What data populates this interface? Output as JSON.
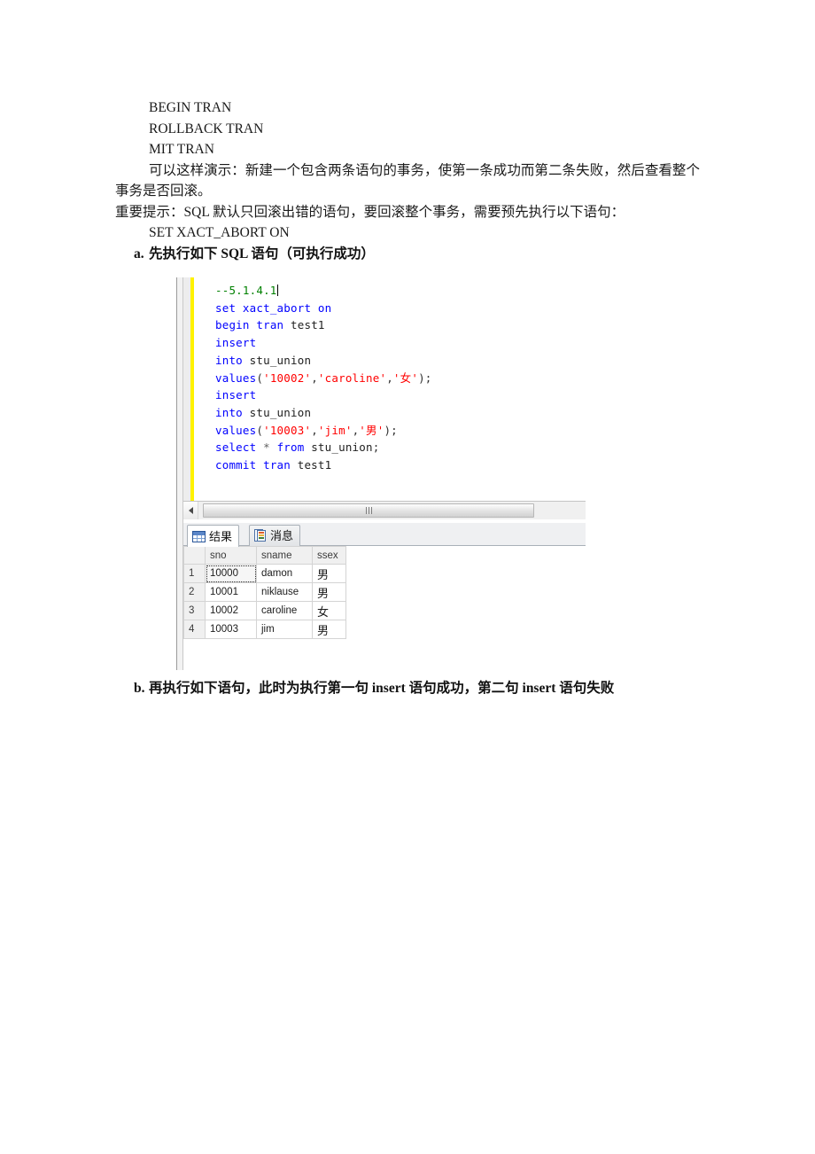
{
  "document": {
    "lines": [
      {
        "id": "l1",
        "text": "BEGIN TRAN"
      },
      {
        "id": "l2",
        "text": "ROLLBACK TRAN"
      },
      {
        "id": "l3",
        "text": "MIT TRAN"
      }
    ],
    "paragraph_1": "可以这样演示：新建一个包含两条语句的事务，使第一条成功而第二条失败，然后查看整个事务是否回滚。",
    "paragraph_2": "重要提示：SQL 默认只回滚出错的语句，要回滚整个事务，需要预先执行以下语句：",
    "statement_line": "SET XACT_ABORT ON",
    "item_a": {
      "marker": "a.",
      "text": "先执行如下 SQL 语句（可执行成功）"
    },
    "item_b": {
      "marker": "b.",
      "text": "再执行如下语句，此时为执行第一句 insert 语句成功，第二句 insert 语句失败"
    }
  },
  "ssms": {
    "editor": {
      "lines": [
        {
          "id": "c1",
          "tokens": [
            {
              "t": "--5.1.4.1",
              "k": "cmt"
            }
          ],
          "caret": true
        },
        {
          "id": "c2",
          "tokens": [
            {
              "t": "set",
              "k": "kw"
            },
            {
              "t": " ",
              "k": "pun"
            },
            {
              "t": "xact_abort",
              "k": "kw"
            },
            {
              "t": " ",
              "k": "pun"
            },
            {
              "t": "on",
              "k": "kw"
            }
          ]
        },
        {
          "id": "c3",
          "tokens": [
            {
              "t": "begin",
              "k": "kw"
            },
            {
              "t": " ",
              "k": "pun"
            },
            {
              "t": "tran",
              "k": "kw"
            },
            {
              "t": " ",
              "k": "pun"
            },
            {
              "t": "test1",
              "k": "idn"
            }
          ]
        },
        {
          "id": "c4",
          "tokens": [
            {
              "t": "insert",
              "k": "kw"
            }
          ]
        },
        {
          "id": "c5",
          "tokens": [
            {
              "t": "into",
              "k": "kw"
            },
            {
              "t": " ",
              "k": "pun"
            },
            {
              "t": "stu_union",
              "k": "idn"
            }
          ]
        },
        {
          "id": "c6",
          "tokens": [
            {
              "t": "values",
              "k": "kw"
            },
            {
              "t": "(",
              "k": "pun"
            },
            {
              "t": "'10002'",
              "k": "str"
            },
            {
              "t": ",",
              "k": "pun"
            },
            {
              "t": "'caroline'",
              "k": "str"
            },
            {
              "t": ",",
              "k": "pun"
            },
            {
              "t": "'女'",
              "k": "str"
            },
            {
              "t": ");",
              "k": "pun"
            }
          ]
        },
        {
          "id": "c7",
          "tokens": [
            {
              "t": "insert",
              "k": "kw"
            }
          ]
        },
        {
          "id": "c8",
          "tokens": [
            {
              "t": "into",
              "k": "kw"
            },
            {
              "t": " ",
              "k": "pun"
            },
            {
              "t": "stu_union",
              "k": "idn"
            }
          ]
        },
        {
          "id": "c9",
          "tokens": [
            {
              "t": "values",
              "k": "kw"
            },
            {
              "t": "(",
              "k": "pun"
            },
            {
              "t": "'10003'",
              "k": "str"
            },
            {
              "t": ",",
              "k": "pun"
            },
            {
              "t": "'jim'",
              "k": "str"
            },
            {
              "t": ",",
              "k": "pun"
            },
            {
              "t": "'男'",
              "k": "str"
            },
            {
              "t": ");",
              "k": "pun"
            }
          ]
        },
        {
          "id": "c10",
          "tokens": [
            {
              "t": "select",
              "k": "kw"
            },
            {
              "t": " ",
              "k": "pun"
            },
            {
              "t": "*",
              "k": "op"
            },
            {
              "t": " ",
              "k": "pun"
            },
            {
              "t": "from",
              "k": "kw"
            },
            {
              "t": " ",
              "k": "pun"
            },
            {
              "t": "stu_union",
              "k": "idn"
            },
            {
              "t": ";",
              "k": "pun"
            }
          ]
        },
        {
          "id": "c11",
          "tokens": [
            {
              "t": "commit",
              "k": "kw"
            },
            {
              "t": " ",
              "k": "pun"
            },
            {
              "t": "tran",
              "k": "kw"
            },
            {
              "t": " ",
              "k": "pun"
            },
            {
              "t": "test1",
              "k": "idn"
            }
          ]
        }
      ],
      "colors": {
        "keyword": "#0000ff",
        "string": "#ff0000",
        "comment": "#008000",
        "change_bar": "#fff200"
      }
    },
    "tabs": [
      {
        "id": "results",
        "label": "结果",
        "icon": "grid-icon",
        "active": true
      },
      {
        "id": "messages",
        "label": "消息",
        "icon": "message-icon",
        "active": false
      }
    ],
    "results_grid": {
      "columns": [
        "sno",
        "sname",
        "ssex"
      ],
      "rows": [
        {
          "n": "1",
          "sno": "10000",
          "sname": "damon",
          "ssex": "男"
        },
        {
          "n": "2",
          "sno": "10001",
          "sname": "niklause",
          "ssex": "男"
        },
        {
          "n": "3",
          "sno": "10002",
          "sname": "caroline",
          "ssex": "女"
        },
        {
          "n": "4",
          "sno": "10003",
          "sname": "jim",
          "ssex": "男"
        }
      ],
      "focused_cell": {
        "row": 1,
        "column": "sno"
      }
    },
    "scrollbar": {
      "orientation": "horizontal",
      "left_arrow": "◀"
    }
  }
}
